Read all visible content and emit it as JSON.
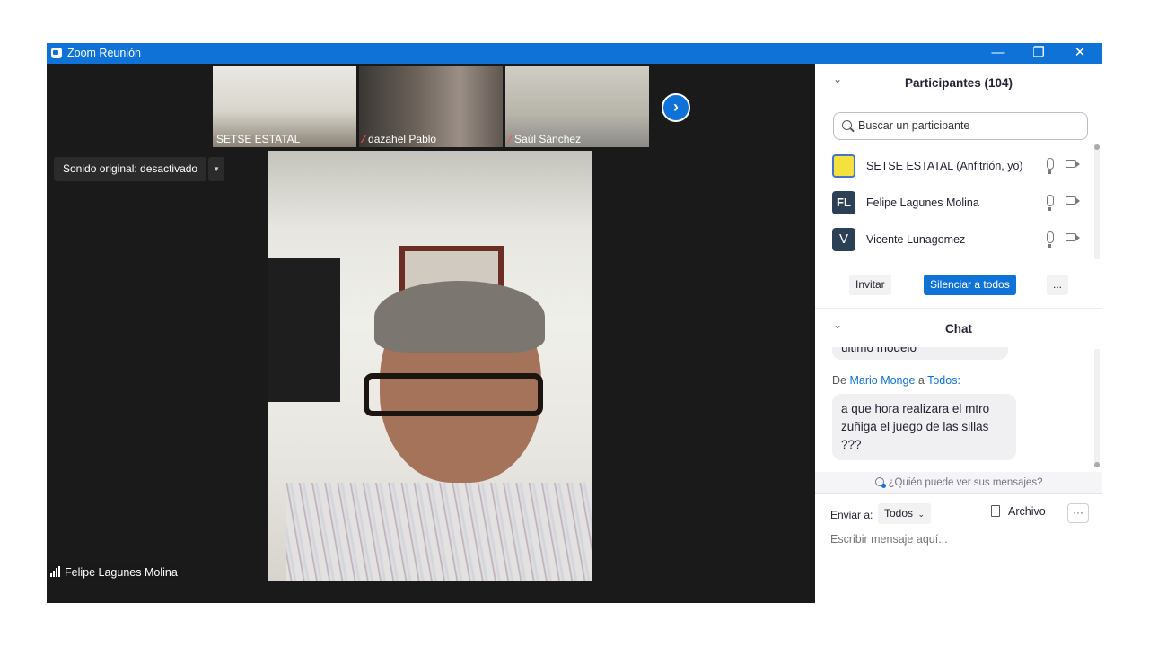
{
  "window": {
    "title": "Zoom Reunión",
    "minimize_glyph": "—",
    "maximize_glyph": "❐",
    "close_glyph": "✕"
  },
  "gallery": {
    "thumbnails": [
      {
        "name": "SETSE ESTATAL",
        "muted": false
      },
      {
        "name": "dazahel Pablo",
        "muted": true
      },
      {
        "name": "Saúl Sánchez",
        "muted": true
      }
    ],
    "next_icon": "chevron-right-icon",
    "next_glyph": "›"
  },
  "sound_button": {
    "label": "Sonido original: desactivado",
    "arrow": "▼"
  },
  "main_video": {
    "speaker_name": "Felipe Lagunes Molina"
  },
  "participants": {
    "title": "Participantes (104)",
    "collapse_glyph": "⌄",
    "search_placeholder": "Buscar un participante",
    "list": [
      {
        "avatar": "",
        "name": "SETSE ESTATAL (Anfitrión, yo)"
      },
      {
        "avatar": "FL",
        "name": "Felipe Lagunes Molina"
      },
      {
        "avatar": "V",
        "name": "Vicente Lunagomez"
      }
    ],
    "buttons": {
      "invite": "Invitar",
      "mute_all": "Silenciar a todos",
      "more": "..."
    }
  },
  "chat": {
    "title": "Chat",
    "collapse_glyph": "⌄",
    "messages": [
      {
        "text": "último modelo"
      },
      {
        "from_prefix": "De",
        "sender": "Mario  Monge",
        "to_word": "a",
        "recipient": "Todos:",
        "text": "a que hora realizara el mtro zuñiga el juego de las sillas ???"
      }
    ],
    "who_sees": "¿Quién puede ver sus mensajes?",
    "send_to_label": "Enviar a:",
    "send_to_value": "Todos",
    "file_label": "Archivo",
    "more_glyph": "···",
    "input_placeholder": "Escribir mensaje aquí..."
  },
  "colors": {
    "accent": "#0e72d6",
    "video_bg": "#1a1a1a",
    "muted_red": "#ff4d4d"
  }
}
